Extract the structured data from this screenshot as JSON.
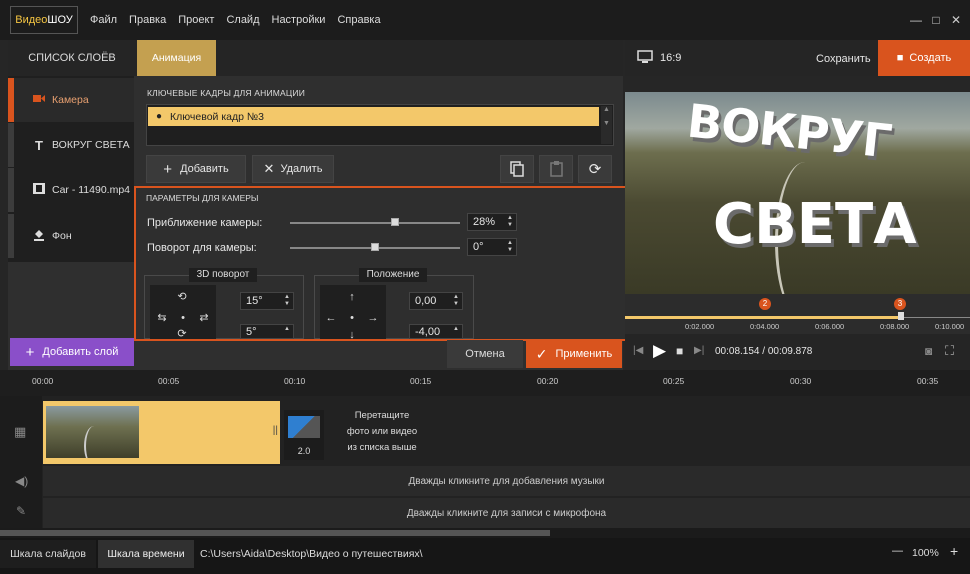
{
  "app": {
    "logo_a": "Видео",
    "logo_b": "ШОУ"
  },
  "menu": [
    "Файл",
    "Правка",
    "Проект",
    "Слайд",
    "Настройки",
    "Справка"
  ],
  "window": {
    "minimize": "—",
    "maximize": "□",
    "close": "✕"
  },
  "tabs": {
    "layers": "СПИСОК СЛОЁВ",
    "animation": "Анимация"
  },
  "layers": [
    {
      "icon": "camera-icon",
      "label": "Камера",
      "active": true
    },
    {
      "icon": "text-icon",
      "label": "ВОКРУГ  СВЕТА",
      "active": false
    },
    {
      "icon": "film-icon",
      "label": "Car - 11490.mp4",
      "active": false
    },
    {
      "icon": "bucket-icon",
      "label": "Фон",
      "active": false
    }
  ],
  "add_layer": "Добавить слой",
  "keyframes": {
    "label": "КЛЮЧЕВЫЕ КАДРЫ ДЛЯ АНИМАЦИИ",
    "items": [
      "Ключевой кадр №3"
    ],
    "add": "Добавить",
    "delete": "Удалить"
  },
  "camera": {
    "title": "ПАРАМЕТРЫ ДЛЯ КАМЕРЫ",
    "zoom_label": "Приближение камеры:",
    "zoom_value": "28%",
    "zoom_fraction": 0.62,
    "rotate_label": "Поворот для камеры:",
    "rotate_value": "0°",
    "rotate_fraction": 0.5,
    "rotation3d_title": "3D поворот",
    "rot_x": "15°",
    "rot_y": "5°",
    "position_title": "Положение",
    "pos_x": "0,00",
    "pos_y": "-4,00"
  },
  "actions": {
    "cancel": "Отмена",
    "apply": "Применить"
  },
  "preview": {
    "aspect": "16:9",
    "save": "Сохранить",
    "create": "Создать",
    "title_line1": "ВОКРУГ",
    "title_line2": "СВЕТА",
    "ruler_ticks": [
      "0:02.000",
      "0:04.000",
      "0:06.000",
      "0:08.000",
      "0:10.000"
    ],
    "markers": [
      "2",
      "3"
    ],
    "time_current": "00:08.154",
    "time_total": "00:09.878",
    "time_separator": "/"
  },
  "timeline": {
    "ticks": [
      "00:00",
      "00:05",
      "00:10",
      "00:15",
      "00:20",
      "00:25",
      "00:30",
      "00:35"
    ],
    "transition_duration": "2.0",
    "drop_hint": "Перетащите\nфото или видео\nиз списка выше",
    "music_hint": "Дважды кликните для добавления музыки",
    "mic_hint": "Дважды кликните для записи с микрофона"
  },
  "status": {
    "tab_slides": "Шкала слайдов",
    "tab_timeline": "Шкала времени",
    "path": "C:\\Users\\Aida\\Desktop\\Видео о путешествиях\\",
    "zoom": "100%",
    "zoom_out": "—",
    "zoom_in": "+"
  },
  "colors": {
    "accent": "#d9541e",
    "keyframe": "#f3c86a",
    "purple": "#8a4fc9",
    "tab": "#c4a050"
  }
}
